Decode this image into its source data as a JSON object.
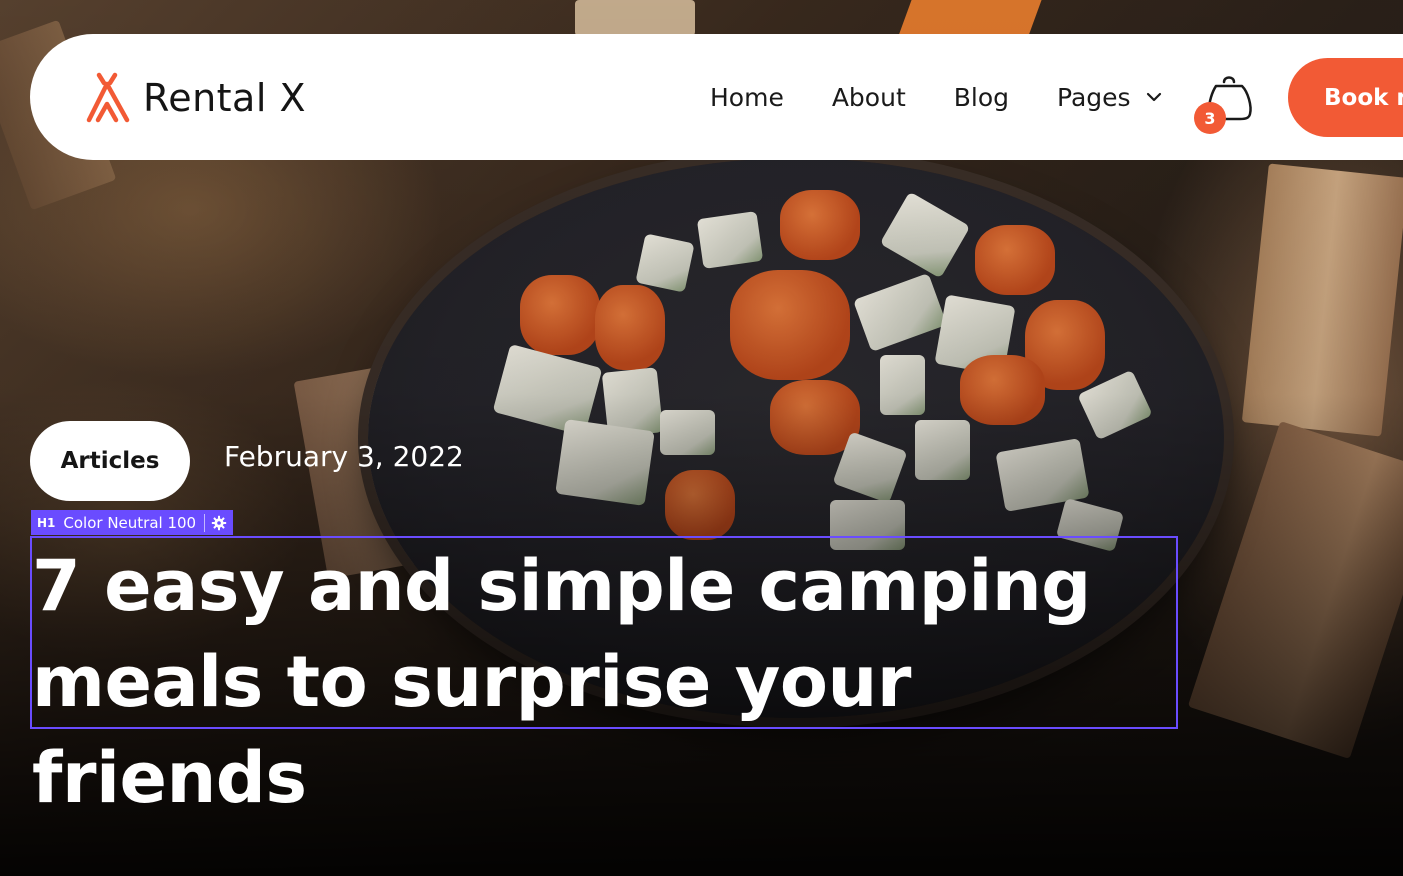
{
  "brand": {
    "name": "Rental X",
    "accent_color": "#f25a35",
    "logo_icon": "tent-icon"
  },
  "nav": {
    "items": [
      {
        "label": "Home"
      },
      {
        "label": "About"
      },
      {
        "label": "Blog"
      },
      {
        "label": "Pages",
        "has_dropdown": true
      }
    ],
    "cart": {
      "icon": "shopping-bag-icon",
      "count": "3"
    },
    "cta_label": "Book n"
  },
  "hero": {
    "background": "campfire pan with vegetables and meat photo",
    "category": "Articles",
    "date": "February 3, 2022",
    "title": "7 easy and simple camping meals to surprise your friends"
  },
  "editor": {
    "selection_tag": {
      "element_type": "H1",
      "label": "Color Neutral 100",
      "settings_icon": "gear-icon",
      "highlight_color": "#6a4cff"
    }
  }
}
